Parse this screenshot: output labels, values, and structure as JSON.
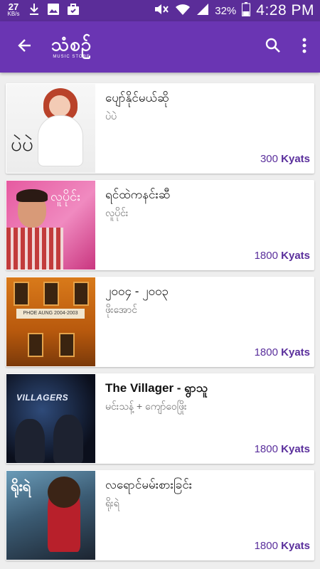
{
  "status_bar": {
    "net_speed": "27",
    "net_speed_unit": "KB/s",
    "battery_percent": "32%",
    "time": "4:28 PM",
    "icons": [
      "download-icon",
      "image-icon",
      "briefcase-icon",
      "mute-icon",
      "wifi-icon",
      "signal-icon",
      "battery-icon"
    ]
  },
  "app_bar": {
    "logo_text": "သံစဥ်",
    "logo_subtitle": "MUSIC STORE",
    "icons": [
      "back-arrow-icon",
      "search-icon",
      "more-vert-icon"
    ],
    "accent": "#6a35b3",
    "status_color": "#5b2d99",
    "price_color": "#5a2f9c"
  },
  "albums": [
    {
      "title": "ပျော်နိုင်မယ်ဆို",
      "artist": "ပဲပဲ",
      "price": "300",
      "currency": "Kyats"
    },
    {
      "title": "ရင်ထဲကနင်းဆီ",
      "artist": "လူပိုင်း",
      "price": "1800",
      "currency": "Kyats"
    },
    {
      "title": "၂၀၀၄ - ၂၀၀၃",
      "artist": "ဖိုးအောင်",
      "price": "1800",
      "currency": "Kyats"
    },
    {
      "title": "The Villager - ရွာသူ",
      "artist": "မင်းသန့် + ကျော်ဝေဖြိုး",
      "price": "1800",
      "currency": "Kyats"
    },
    {
      "title": "လရောင်မမ်းစားခြင်း",
      "artist": "ရိုးရဲ",
      "price": "1800",
      "currency": "Kyats"
    }
  ]
}
